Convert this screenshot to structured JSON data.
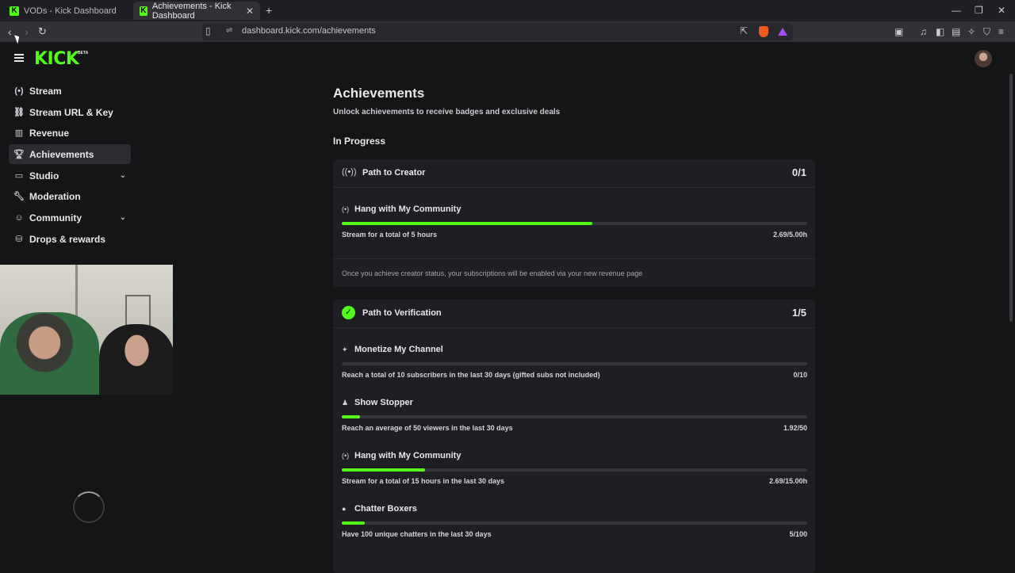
{
  "browser": {
    "tabs": [
      {
        "title": "VODs - Kick Dashboard",
        "active": false
      },
      {
        "title": "Achievements - Kick Dashboard",
        "active": true
      }
    ],
    "url": "dashboard.kick.com/achievements"
  },
  "brand": {
    "logo": "KICK",
    "badge": "BETA",
    "accent": "#53fc18"
  },
  "sidebar": {
    "items": [
      {
        "label": "Stream",
        "icon": "broadcast-icon",
        "active": false
      },
      {
        "label": "Stream URL & Key",
        "icon": "link-icon",
        "active": false
      },
      {
        "label": "Revenue",
        "icon": "chart-icon",
        "active": false
      },
      {
        "label": "Achievements",
        "icon": "trophy-icon",
        "active": true
      },
      {
        "label": "Studio",
        "icon": "studio-icon",
        "active": false,
        "expandable": true
      },
      {
        "label": "Moderation",
        "icon": "wrench-icon",
        "active": false
      },
      {
        "label": "Community",
        "icon": "community-icon",
        "active": false,
        "expandable": true
      },
      {
        "label": "Drops & rewards",
        "icon": "gift-icon",
        "active": false
      }
    ]
  },
  "main": {
    "title": "Achievements",
    "subtitle": "Unlock achievements to receive badges and exclusive deals",
    "section": "In Progress",
    "cards": [
      {
        "title": "Path to Creator",
        "count": "0/1",
        "icon": "broadcast-icon",
        "achievements": [
          {
            "name": "Hang with My Community",
            "desc": "Stream for a total of 5 hours",
            "progress": "2.69/5.00h",
            "fraction": 0.538
          }
        ],
        "note": "Once you achieve creator status, your subscriptions will be enabled via your new revenue page"
      },
      {
        "title": "Path to Verification",
        "count": "1/5",
        "icon": "verified-check-icon",
        "achievements": [
          {
            "name": "Monetize My Channel",
            "desc": "Reach a total of 10 subscribers in the last 30 days (gifted subs not included)",
            "progress": "0/10",
            "fraction": 0
          },
          {
            "name": "Show Stopper",
            "desc": "Reach an average of 50 viewers in the last 30 days",
            "progress": "1.92/50",
            "fraction": 0.0384
          },
          {
            "name": "Hang with My Community",
            "desc": "Stream for a total of 15 hours in the last 30 days",
            "progress": "2.69/15.00h",
            "fraction": 0.179
          },
          {
            "name": "Chatter Boxers",
            "desc": "Have 100 unique chatters in the last 30 days",
            "progress": "5/100",
            "fraction": 0.05
          }
        ]
      }
    ]
  }
}
